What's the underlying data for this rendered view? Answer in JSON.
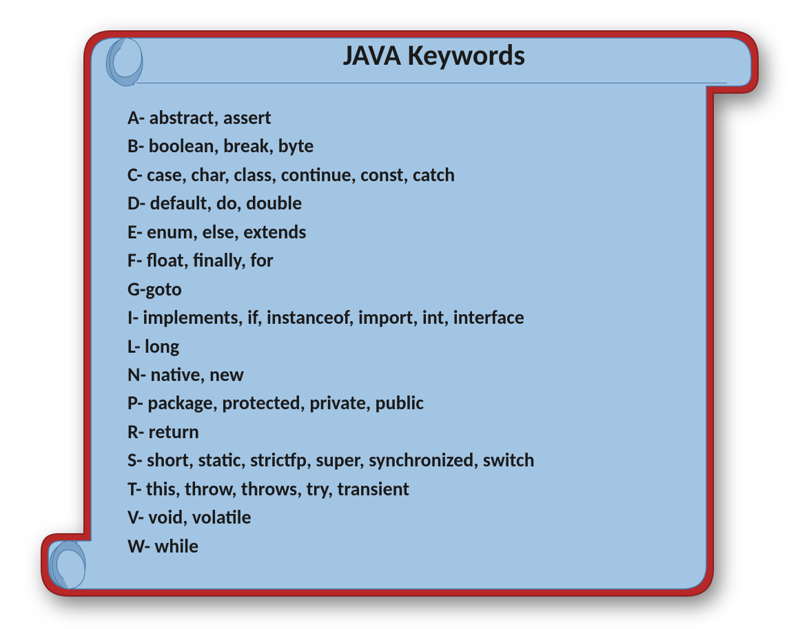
{
  "title": "JAVA Keywords",
  "keywords": [
    "A- abstract, assert",
    "B- boolean, break, byte",
    "C- case, char, class, continue, const, catch",
    "D- default, do, double",
    "E- enum, else, extends",
    "F- float, finally, for",
    "G-goto",
    "I- implements, if, instanceof, import, int, interface",
    "L- long",
    "N- native, new",
    "P- package, protected, private, public",
    "R- return",
    "S- short, static, strictfp, super, synchronized, switch",
    "T- this, throw, throws, try, transient",
    "V- void, volatile",
    "W- while"
  ]
}
